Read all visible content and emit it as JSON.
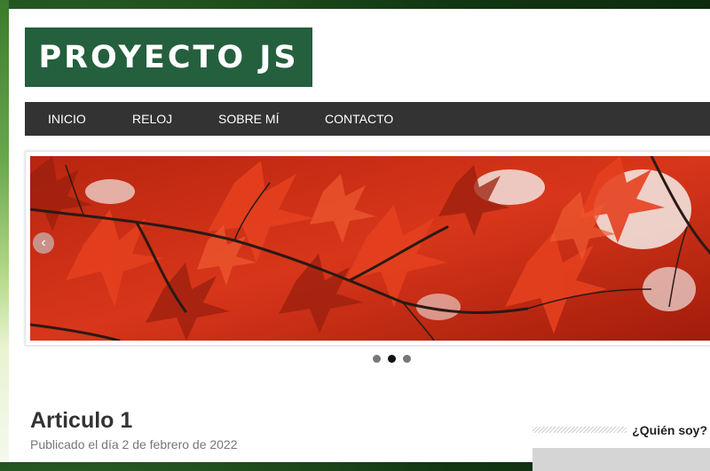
{
  "site": {
    "logo_text": "PROYECTO JS"
  },
  "nav": {
    "items": [
      {
        "label": "INICIO"
      },
      {
        "label": "RELOJ"
      },
      {
        "label": "SOBRE MÍ"
      },
      {
        "label": "CONTACTO"
      }
    ]
  },
  "slider": {
    "prev_glyph": "‹",
    "slide_count": 3,
    "active_index": 1,
    "colors": {
      "leaf_red": "#d8361a",
      "leaf_dark": "#8e1a0c",
      "branch": "#2a1a14"
    }
  },
  "article": {
    "title": "Articulo 1",
    "meta": "Publicado el día 2 de febrero de 2022"
  },
  "sidebar": {
    "widget_title": "¿Quién soy?"
  },
  "colors": {
    "logo_bg": "#245f3e",
    "nav_bg": "#333333"
  }
}
